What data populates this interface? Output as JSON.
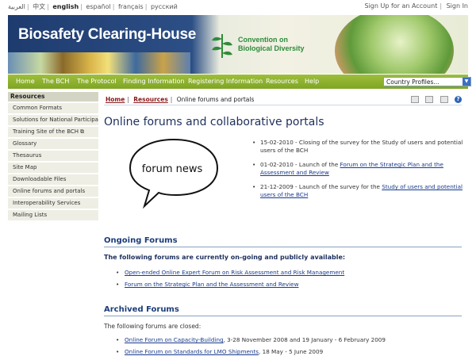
{
  "languages": [
    {
      "label": "العربية",
      "active": false
    },
    {
      "label": "中文",
      "active": false
    },
    {
      "label": "english",
      "active": true
    },
    {
      "label": "español",
      "active": false
    },
    {
      "label": "français",
      "active": false
    },
    {
      "label": "русский",
      "active": false
    }
  ],
  "account": {
    "signup": "Sign Up for an Account",
    "signin": "Sign In"
  },
  "banner": {
    "title": "Biosafety Clearing-House",
    "cbd_line1": "Convention on",
    "cbd_line2": "Biological Diversity"
  },
  "nav": {
    "items": [
      "Home",
      "The BCH",
      "The Protocol",
      "Finding Information",
      "Registering Information",
      "Resources",
      "Help"
    ],
    "profile_select": "Country Profiles..."
  },
  "sidebar": {
    "heading": "Resources",
    "items": [
      "Common Formats",
      "Solutions for National Participation",
      "Training Site of the BCH",
      "Glossary",
      "Thesaurus",
      "Site Map",
      "Downloadable Files",
      "Online forums and portals",
      "Interoperability Services",
      "Mailing Lists"
    ]
  },
  "breadcrumb": {
    "home": "Home",
    "resources": "Resources",
    "current": "Online forums and portals"
  },
  "page_title": "Online forums and collaborative portals",
  "bubble_text": "forum news",
  "news": [
    {
      "pre": "15-02-2010 - Closing of the survey for the Study of users and potential users of the BCH",
      "link": "",
      "post": ""
    },
    {
      "pre": "01-02-2010 - Launch of the ",
      "link": "Forum on the Strategic Plan and the Assessment and Review",
      "post": ""
    },
    {
      "pre": "21-12-2009 - Launch of the survey for the ",
      "link": "Study of users and potential users of the BCH",
      "post": ""
    }
  ],
  "ongoing": {
    "title": "Ongoing Forums",
    "subtitle": "The following forums are currently on-going and publicly available:",
    "links": [
      "Open-ended Online Expert Forum on Risk Assessment and Risk Management",
      "Forum on the Strategic Plan and the Assessment and Review"
    ]
  },
  "archived": {
    "title": "Archived Forums",
    "text": "The following forums are closed:",
    "items": [
      {
        "link": "Online Forum on Capacity-Building",
        "dates": ", 3-28 November 2008 and 19 January - 6 February 2009"
      },
      {
        "link": "Online Forum on Standards for LMO Shipments",
        "dates": ", 18 May - 5 June 2009"
      }
    ]
  },
  "colors": {
    "nav_green": "#8db030",
    "title_blue": "#1d2f5c",
    "crumb_red": "#8b1a1a",
    "cbd_green": "#2e8b3a"
  }
}
